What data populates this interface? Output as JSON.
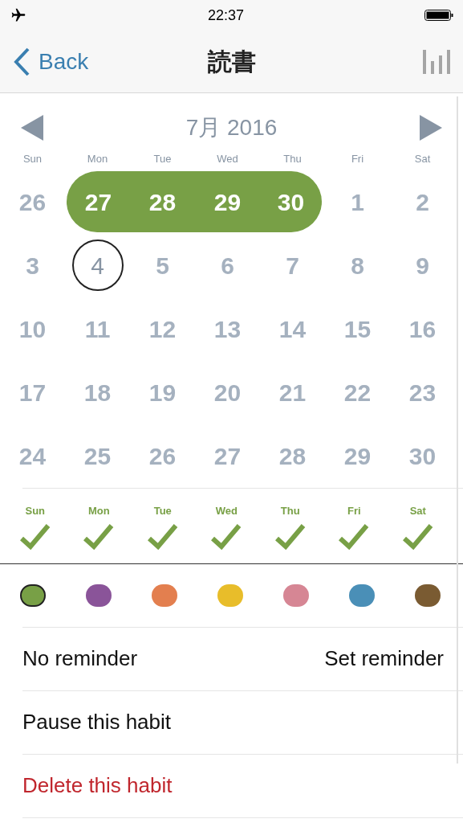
{
  "status_bar": {
    "time": "22:37"
  },
  "nav": {
    "back": "Back",
    "title": "読書"
  },
  "calendar": {
    "month": "7月 2016",
    "weekdays": [
      "Sun",
      "Mon",
      "Tue",
      "Wed",
      "Thu",
      "Fri",
      "Sat"
    ],
    "days": [
      {
        "label": "26",
        "selected": false,
        "today": false
      },
      {
        "label": "27",
        "selected": true,
        "today": false
      },
      {
        "label": "28",
        "selected": true,
        "today": false
      },
      {
        "label": "29",
        "selected": true,
        "today": false
      },
      {
        "label": "30",
        "selected": true,
        "today": false
      },
      {
        "label": "1",
        "selected": false,
        "today": false
      },
      {
        "label": "2",
        "selected": false,
        "today": false
      },
      {
        "label": "3",
        "selected": false,
        "today": false
      },
      {
        "label": "4",
        "selected": false,
        "today": true
      },
      {
        "label": "5",
        "selected": false,
        "today": false
      },
      {
        "label": "6",
        "selected": false,
        "today": false
      },
      {
        "label": "7",
        "selected": false,
        "today": false
      },
      {
        "label": "8",
        "selected": false,
        "today": false
      },
      {
        "label": "9",
        "selected": false,
        "today": false
      },
      {
        "label": "10",
        "selected": false,
        "today": false
      },
      {
        "label": "11",
        "selected": false,
        "today": false
      },
      {
        "label": "12",
        "selected": false,
        "today": false
      },
      {
        "label": "13",
        "selected": false,
        "today": false
      },
      {
        "label": "14",
        "selected": false,
        "today": false
      },
      {
        "label": "15",
        "selected": false,
        "today": false
      },
      {
        "label": "16",
        "selected": false,
        "today": false
      },
      {
        "label": "17",
        "selected": false,
        "today": false
      },
      {
        "label": "18",
        "selected": false,
        "today": false
      },
      {
        "label": "19",
        "selected": false,
        "today": false
      },
      {
        "label": "20",
        "selected": false,
        "today": false
      },
      {
        "label": "21",
        "selected": false,
        "today": false
      },
      {
        "label": "22",
        "selected": false,
        "today": false
      },
      {
        "label": "23",
        "selected": false,
        "today": false
      },
      {
        "label": "24",
        "selected": false,
        "today": false
      },
      {
        "label": "25",
        "selected": false,
        "today": false
      },
      {
        "label": "26",
        "selected": false,
        "today": false
      },
      {
        "label": "27",
        "selected": false,
        "today": false
      },
      {
        "label": "28",
        "selected": false,
        "today": false
      },
      {
        "label": "29",
        "selected": false,
        "today": false
      },
      {
        "label": "30",
        "selected": false,
        "today": false
      }
    ]
  },
  "repeat_days": [
    {
      "label": "Sun",
      "checked": true
    },
    {
      "label": "Mon",
      "checked": true
    },
    {
      "label": "Tue",
      "checked": true
    },
    {
      "label": "Wed",
      "checked": true
    },
    {
      "label": "Thu",
      "checked": true
    },
    {
      "label": "Fri",
      "checked": true
    },
    {
      "label": "Sat",
      "checked": true
    }
  ],
  "colors": [
    {
      "color": "#78a046",
      "selected": true
    },
    {
      "color": "#8a5499",
      "selected": false
    },
    {
      "color": "#e37f4f",
      "selected": false
    },
    {
      "color": "#e8bd2a",
      "selected": false
    },
    {
      "color": "#d68694",
      "selected": false
    },
    {
      "color": "#4a8fb7",
      "selected": false
    },
    {
      "color": "#7a5b32",
      "selected": false
    }
  ],
  "reminder": {
    "label": "No reminder",
    "action": "Set reminder"
  },
  "actions": [
    {
      "label": "Pause this habit",
      "kind": "normal"
    },
    {
      "label": "Delete this habit",
      "kind": "danger"
    }
  ]
}
